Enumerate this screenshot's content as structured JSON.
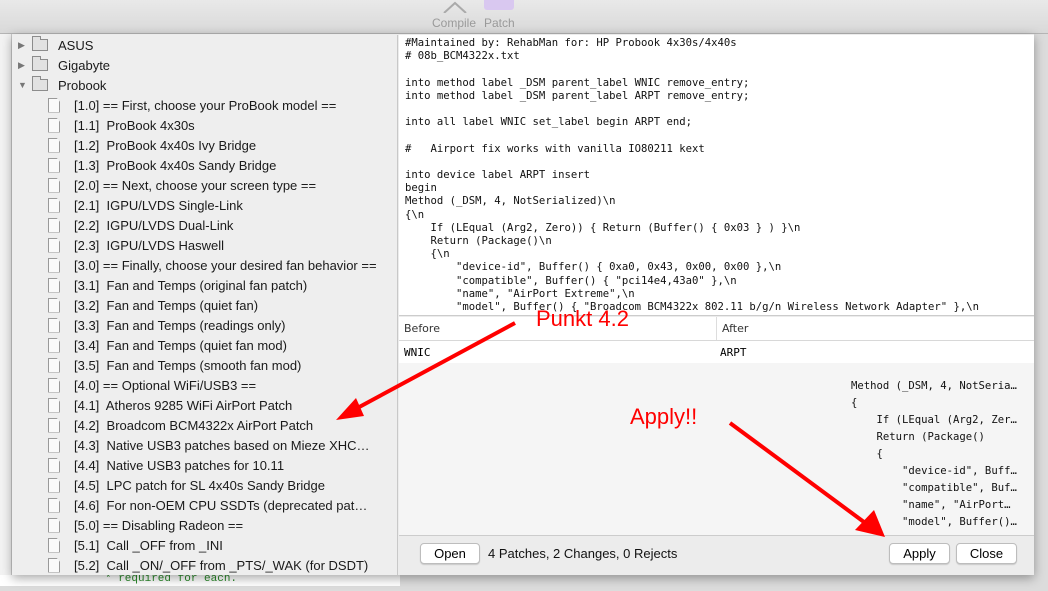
{
  "toolbar": {
    "compile_label": "Compile",
    "patch_label": "Patch"
  },
  "tree": {
    "folders": [
      {
        "label": "ASUS",
        "expanded": false
      },
      {
        "label": "Gigabyte",
        "expanded": false
      },
      {
        "label": "Probook",
        "expanded": true
      }
    ],
    "items": [
      "[1.0] == First, choose your ProBook model ==",
      "[1.1]  ProBook 4x30s",
      "[1.2]  ProBook 4x40s Ivy Bridge",
      "[1.3]  ProBook 4x40s Sandy Bridge",
      "[2.0] == Next, choose your screen type ==",
      "[2.1]  IGPU/LVDS Single-Link",
      "[2.2]  IGPU/LVDS Dual-Link",
      "[2.3]  IGPU/LVDS Haswell",
      "[3.0] == Finally, choose your desired fan behavior ==",
      "[3.1]  Fan and Temps (original fan patch)",
      "[3.2]  Fan and Temps (quiet fan)",
      "[3.3]  Fan and Temps (readings only)",
      "[3.4]  Fan and Temps (quiet fan mod)",
      "[3.5]  Fan and Temps (smooth fan mod)",
      "[4.0] == Optional WiFi/USB3 ==",
      "[4.1]  Atheros 9285 WiFi AirPort Patch",
      "[4.2]  Broadcom BCM4322x AirPort Patch",
      "[4.3]  Native USB3 patches based on Mieze XHC…",
      "[4.4]  Native USB3 patches for 10.11",
      "[4.5]  LPC patch for SL 4x40s Sandy Bridge",
      "[4.6]  For non-OEM CPU SSDTs (deprecated pat…",
      "[5.0] == Disabling Radeon ==",
      "[5.1]  Call _OFF from _INI",
      "[5.2]  Call _ON/_OFF from _PTS/_WAK (for DSDT)"
    ]
  },
  "code": "#Maintained by: RehabMan for: HP Probook 4x30s/4x40s\n# 08b_BCM4322x.txt\n\ninto method label _DSM parent_label WNIC remove_entry;\ninto method label _DSM parent_label ARPT remove_entry;\n\ninto all label WNIC set_label begin ARPT end;\n\n#   Airport fix works with vanilla IO80211 kext\n\ninto device label ARPT insert\nbegin\nMethod (_DSM, 4, NotSerialized)\\n\n{\\n\n    If (LEqual (Arg2, Zero)) { Return (Buffer() { 0x03 } ) }\\n\n    Return (Package()\\n\n    {\\n\n        \"device-id\", Buffer() { 0xa0, 0x43, 0x00, 0x00 },\\n\n        \"compatible\", Buffer() { \"pci14e4,43a0\" },\\n\n        \"name\", \"AirPort Extreme\",\\n\n        \"model\", Buffer() { \"Broadcom BCM4322x 802.11 b/g/n Wireless Network Adapter\" },\\n\n        \"AAPL,slot-name\", Buffer() { \"AirPort\" },\\n",
  "table": {
    "headers": [
      "Before",
      "After"
    ],
    "rows": [
      [
        "WNIC",
        "ARPT"
      ]
    ]
  },
  "preview": "Method (_DSM, 4, NotSeria…\n{\n    If (LEqual (Arg2, Zer…\n    Return (Package()\n    {\n        \"device-id\", Buff…\n        \"compatible\", Buf…\n        \"name\", \"AirPort…\n        \"model\", Buffer()…",
  "footer": {
    "open_label": "Open",
    "status": "4 Patches, 2 Changes, 0 Rejects",
    "apply_label": "Apply",
    "close_label": "Close"
  },
  "background": {
    "partial_text": "* required for each."
  },
  "annotations": {
    "punkt": "Punkt 4.2",
    "apply": "Apply!!",
    "color": "#ff0000"
  }
}
